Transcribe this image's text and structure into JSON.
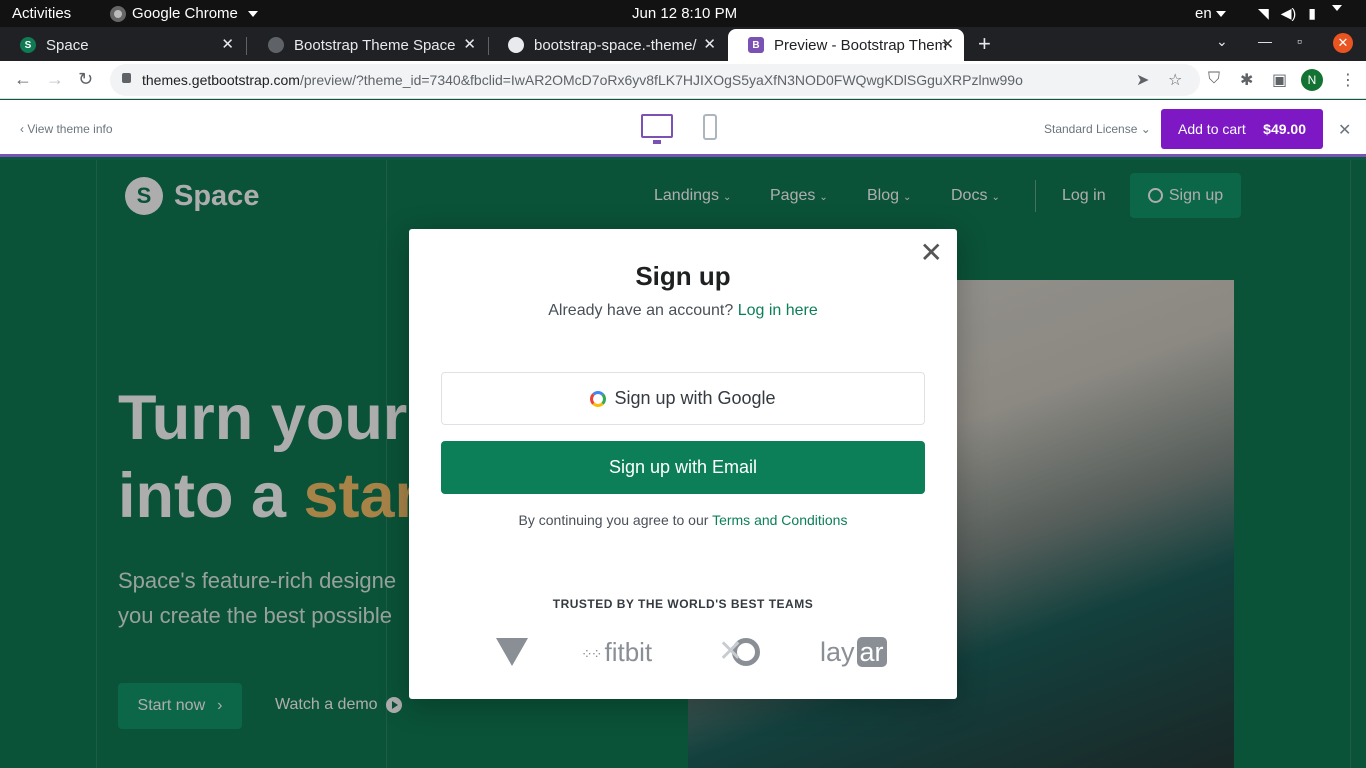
{
  "topbar": {
    "activities": "Activities",
    "app_name": "Google Chrome",
    "clock": "Jun 12  8:10 PM",
    "lang": "en"
  },
  "tabs": [
    {
      "label": "Space",
      "favicon": "S",
      "favicon_color": "#0f7a53"
    },
    {
      "label": "Bootstrap Theme Space",
      "favicon": "",
      "favicon_color": "#5f6368"
    },
    {
      "label": "bootstrap-space.-theme/",
      "favicon": "",
      "favicon_color": "#e8eaed"
    },
    {
      "label": "Preview - Bootstrap Them",
      "favicon": "B",
      "favicon_color": "#7952b3"
    }
  ],
  "address": {
    "host": "themes.getbootstrap.com",
    "path": "/preview/?theme_id=7340&fbclid=IwAR2OMcD7oRx6yv8fLK7HJIXOgS5yaXfN3NOD0FWQwgKDlSGguXRPzlnw99o",
    "profile_initial": "N"
  },
  "preview_bar": {
    "view_theme_info": "View theme info",
    "license": "Standard License",
    "add_to_cart": "Add to cart",
    "price": "$49.00"
  },
  "site": {
    "logo_letter": "S",
    "logo_text": "Space",
    "nav": [
      "Landings",
      "Pages",
      "Blog",
      "Docs"
    ],
    "login": "Log in",
    "signup": "Sign up",
    "hero_line1": "Turn your",
    "hero_line2_plain": "into a ",
    "hero_line2_accent": "start",
    "hero_p1": "Space's feature-rich designe",
    "hero_p2": "you create the best possible",
    "start_now": "Start now",
    "watch_demo": "Watch a demo"
  },
  "modal": {
    "title": "Sign up",
    "have_account": "Already have an account?",
    "login_link": "Log in here",
    "google_btn": "Sign up with Google",
    "email_btn": "Sign up with Email",
    "terms_prefix": "By continuing you agree to our",
    "terms_link": "Terms and Conditions",
    "trusted": "TRUSTED BY THE WORLD'S BEST TEAMS",
    "logos": [
      "gitlab",
      "fitbit",
      "xamarin",
      "layar"
    ],
    "fitbit_text": "fitbit",
    "layar_text_a": "lay",
    "layar_text_b": "ar"
  },
  "colors": {
    "brand_green": "#0d7f58",
    "bootstrap_purple": "#7d18c4"
  }
}
